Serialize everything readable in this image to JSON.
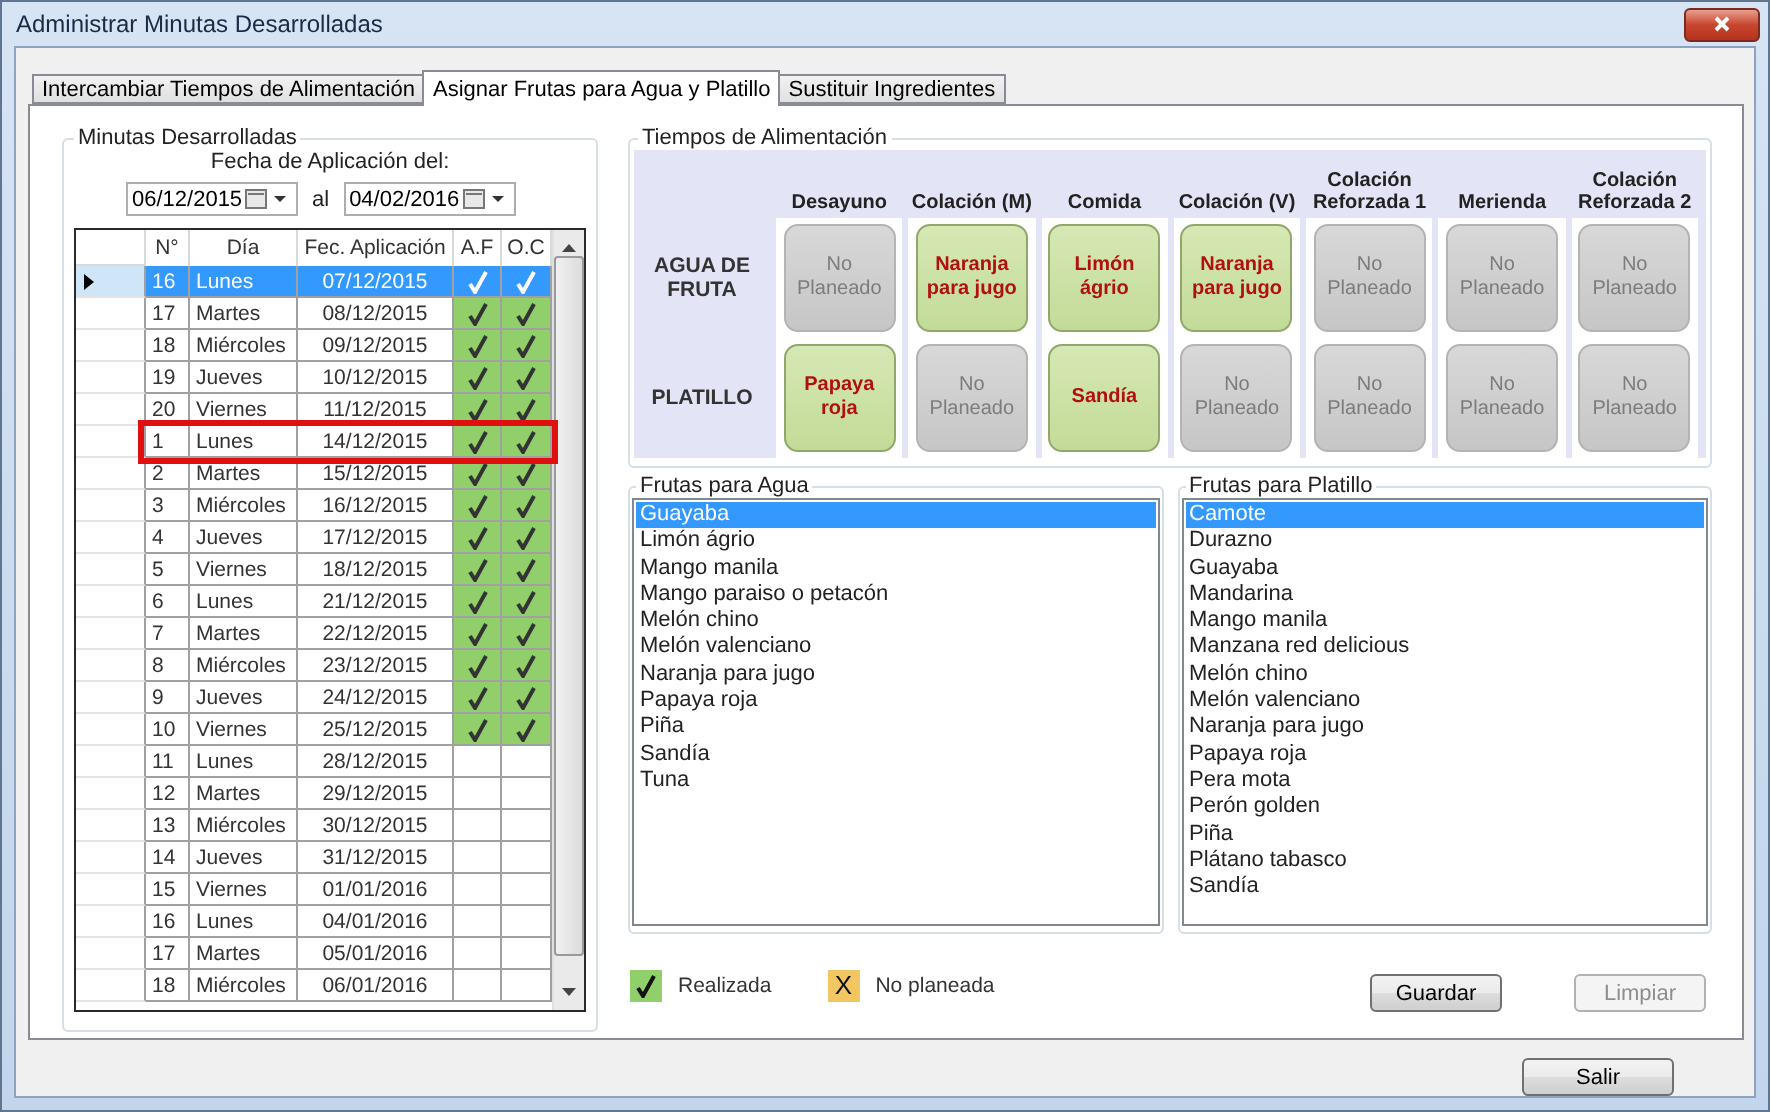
{
  "window": {
    "title": "Administrar Minutas Desarrolladas"
  },
  "tabs": [
    {
      "label": "Intercambiar Tiempos de Alimentación",
      "selected": false
    },
    {
      "label": "Asignar Frutas para Agua y Platillo",
      "selected": true
    },
    {
      "label": "Sustituir Ingredientes",
      "selected": false
    }
  ],
  "minutas": {
    "legend": "Minutas Desarrolladas",
    "date_label": "Fecha de Aplicación del:",
    "date_from": "06/12/2015",
    "separator": "al",
    "date_to": "04/02/2016",
    "columns": [
      "N°",
      "Día",
      "Fec. Aplicación",
      "A.F",
      "O.C"
    ],
    "rows": [
      {
        "n": "16",
        "day": "Lunes",
        "date": "07/12/2015",
        "af": true,
        "oc": true,
        "selected": true,
        "marked": false
      },
      {
        "n": "17",
        "day": "Martes",
        "date": "08/12/2015",
        "af": true,
        "oc": true,
        "selected": false,
        "marked": false
      },
      {
        "n": "18",
        "day": "Miércoles",
        "date": "09/12/2015",
        "af": true,
        "oc": true,
        "selected": false,
        "marked": false
      },
      {
        "n": "19",
        "day": "Jueves",
        "date": "10/12/2015",
        "af": true,
        "oc": true,
        "selected": false,
        "marked": false
      },
      {
        "n": "20",
        "day": "Viernes",
        "date": "11/12/2015",
        "af": true,
        "oc": true,
        "selected": false,
        "marked": false
      },
      {
        "n": "1",
        "day": "Lunes",
        "date": "14/12/2015",
        "af": true,
        "oc": true,
        "selected": false,
        "marked": true
      },
      {
        "n": "2",
        "day": "Martes",
        "date": "15/12/2015",
        "af": true,
        "oc": true,
        "selected": false,
        "marked": false
      },
      {
        "n": "3",
        "day": "Miércoles",
        "date": "16/12/2015",
        "af": true,
        "oc": true,
        "selected": false,
        "marked": false
      },
      {
        "n": "4",
        "day": "Jueves",
        "date": "17/12/2015",
        "af": true,
        "oc": true,
        "selected": false,
        "marked": false
      },
      {
        "n": "5",
        "day": "Viernes",
        "date": "18/12/2015",
        "af": true,
        "oc": true,
        "selected": false,
        "marked": false
      },
      {
        "n": "6",
        "day": "Lunes",
        "date": "21/12/2015",
        "af": true,
        "oc": true,
        "selected": false,
        "marked": false
      },
      {
        "n": "7",
        "day": "Martes",
        "date": "22/12/2015",
        "af": true,
        "oc": true,
        "selected": false,
        "marked": false
      },
      {
        "n": "8",
        "day": "Miércoles",
        "date": "23/12/2015",
        "af": true,
        "oc": true,
        "selected": false,
        "marked": false
      },
      {
        "n": "9",
        "day": "Jueves",
        "date": "24/12/2015",
        "af": true,
        "oc": true,
        "selected": false,
        "marked": false
      },
      {
        "n": "10",
        "day": "Viernes",
        "date": "25/12/2015",
        "af": true,
        "oc": true,
        "selected": false,
        "marked": false
      },
      {
        "n": "11",
        "day": "Lunes",
        "date": "28/12/2015",
        "af": false,
        "oc": false,
        "selected": false,
        "marked": false
      },
      {
        "n": "12",
        "day": "Martes",
        "date": "29/12/2015",
        "af": false,
        "oc": false,
        "selected": false,
        "marked": false
      },
      {
        "n": "13",
        "day": "Miércoles",
        "date": "30/12/2015",
        "af": false,
        "oc": false,
        "selected": false,
        "marked": false
      },
      {
        "n": "14",
        "day": "Jueves",
        "date": "31/12/2015",
        "af": false,
        "oc": false,
        "selected": false,
        "marked": false
      },
      {
        "n": "15",
        "day": "Viernes",
        "date": "01/01/2016",
        "af": false,
        "oc": false,
        "selected": false,
        "marked": false
      },
      {
        "n": "16",
        "day": "Lunes",
        "date": "04/01/2016",
        "af": false,
        "oc": false,
        "selected": false,
        "marked": false
      },
      {
        "n": "17",
        "day": "Martes",
        "date": "05/01/2016",
        "af": false,
        "oc": false,
        "selected": false,
        "marked": false
      },
      {
        "n": "18",
        "day": "Miércoles",
        "date": "06/01/2016",
        "af": false,
        "oc": false,
        "selected": false,
        "marked": false
      }
    ]
  },
  "tiempos": {
    "legend": "Tiempos de Alimentación",
    "meals": [
      "Desayuno",
      "Colación (M)",
      "Comida",
      "Colación (V)",
      "Colación Reforzada 1",
      "Merienda",
      "Colación Reforzada 2"
    ],
    "rows": [
      {
        "label": "AGUA DE FRUTA",
        "cells": [
          {
            "text": "No Planeado",
            "planned": false
          },
          {
            "text": "Naranja para jugo",
            "planned": true
          },
          {
            "text": "Limón ágrio",
            "planned": true
          },
          {
            "text": "Naranja para jugo",
            "planned": true
          },
          {
            "text": "No Planeado",
            "planned": false
          },
          {
            "text": "No Planeado",
            "planned": false
          },
          {
            "text": "No Planeado",
            "planned": false
          }
        ]
      },
      {
        "label": "PLATILLO",
        "cells": [
          {
            "text": "Papaya roja",
            "planned": true
          },
          {
            "text": "No Planeado",
            "planned": false
          },
          {
            "text": "Sandía",
            "planned": true
          },
          {
            "text": "No Planeado",
            "planned": false
          },
          {
            "text": "No Planeado",
            "planned": false
          },
          {
            "text": "No Planeado",
            "planned": false
          },
          {
            "text": "No Planeado",
            "planned": false
          }
        ]
      }
    ]
  },
  "frutas_agua": {
    "legend": "Frutas para Agua",
    "items": [
      {
        "text": "Guayaba",
        "selected": true
      },
      {
        "text": "Limón ágrio",
        "selected": false
      },
      {
        "text": "Mango manila",
        "selected": false
      },
      {
        "text": "Mango paraiso o petacón",
        "selected": false
      },
      {
        "text": "Melón chino",
        "selected": false
      },
      {
        "text": "Melón valenciano",
        "selected": false
      },
      {
        "text": "Naranja para jugo",
        "selected": false
      },
      {
        "text": "Papaya roja",
        "selected": false
      },
      {
        "text": "Piña",
        "selected": false
      },
      {
        "text": "Sandía",
        "selected": false
      },
      {
        "text": "Tuna",
        "selected": false
      }
    ]
  },
  "frutas_platillo": {
    "legend": "Frutas para Platillo",
    "items": [
      {
        "text": "Camote",
        "selected": true
      },
      {
        "text": "Durazno",
        "selected": false
      },
      {
        "text": "Guayaba",
        "selected": false
      },
      {
        "text": "Mandarina",
        "selected": false
      },
      {
        "text": "Mango manila",
        "selected": false
      },
      {
        "text": "Manzana red delicious",
        "selected": false
      },
      {
        "text": "Melón chino",
        "selected": false
      },
      {
        "text": "Melón valenciano",
        "selected": false
      },
      {
        "text": "Naranja para jugo",
        "selected": false
      },
      {
        "text": "Papaya roja",
        "selected": false
      },
      {
        "text": "Pera mota",
        "selected": false
      },
      {
        "text": "Perón golden",
        "selected": false
      },
      {
        "text": "Piña",
        "selected": false
      },
      {
        "text": "Plátano tabasco",
        "selected": false
      },
      {
        "text": "Sandía",
        "selected": false
      }
    ]
  },
  "legend": [
    {
      "kind": "check",
      "label": "Realizada"
    },
    {
      "kind": "symbol",
      "symbol": "X",
      "label": "No planeada"
    }
  ],
  "buttons": [
    {
      "label": "Guardar",
      "disabled": false
    },
    {
      "label": "Limpiar",
      "disabled": true
    }
  ],
  "footer_button": "Salir"
}
